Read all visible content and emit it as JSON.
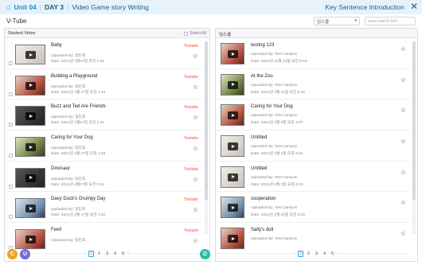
{
  "header": {
    "unit": "Unit 04",
    "day": "DAY 3",
    "lesson": "Video Game story Writing",
    "link": "Key Sentence Introduction"
  },
  "toolbar": {
    "section_title": "V-Tube",
    "sort_value": "임스쿨",
    "search_placeholder": "input search text"
  },
  "left_panel": {
    "title": "Student Video",
    "select_all": "Select All",
    "items": [
      {
        "title": "Baby",
        "uploaded": "Uploaded By: 정민호",
        "date": "Date: 2021년 4월27일 오전 1:25",
        "source": "Youtube",
        "thumb": "light"
      },
      {
        "title": "Building a Playground",
        "uploaded": "Uploaded By: 정민호",
        "date": "Date: 2021년 4월 27일 오전 1:43",
        "source": "Youtube",
        "thumb": "red"
      },
      {
        "title": "Buzz and Ted Are Friends",
        "uploaded": "Uploaded By: 정민호",
        "date": "Date: 2021년 4월27일 오전 1:43",
        "source": "Youtube",
        "thumb": "dark"
      },
      {
        "title": "Caring for Your Dog",
        "uploaded": "Uploaded By: 정민호",
        "date": "Date: 2021년 4월 27일 오전 1:53",
        "source": "Youtube",
        "thumb": "green"
      },
      {
        "title": "Dinosaur",
        "uploaded": "Uploaded By: 정민호",
        "date": "Date: 2021년 4월27일 오전 0:53",
        "source": "Youtube",
        "thumb": "dark"
      },
      {
        "title": "Davy Duck's Grumpy Day",
        "uploaded": "Uploaded By: 정민호",
        "date": "Date: 2021년 4월 27일 오전 1:40",
        "source": "Youtube",
        "thumb": "blue"
      },
      {
        "title": "Feet!",
        "uploaded": "Uploaded By: 정민호",
        "date": "",
        "source": "Youtube",
        "thumb": "red"
      }
    ],
    "pages": [
      "1",
      "2",
      "3",
      "4",
      "5"
    ]
  },
  "right_panel": {
    "title": "임스쿨",
    "items": [
      {
        "title": "testing 123",
        "uploaded": "Uploaded By: Test Campus",
        "date": "Date: 2021년 11월 24일 오전 6:18",
        "thumb": "red"
      },
      {
        "title": "At the Zoo",
        "uploaded": "Uploaded By: Test Campus",
        "date": "Date: 2021년 3월 11일 오전 6:48",
        "thumb": "green"
      },
      {
        "title": "Caring for Your Dog",
        "uploaded": "Uploaded By: Test Campus",
        "date": "Date: 2021년 3월 8일 오후 2:07",
        "thumb": "red"
      },
      {
        "title": "Untitled",
        "uploaded": "Uploaded By: Test Campus",
        "date": "Date: 2021년 2월 2일 오후 6:02",
        "thumb": "light"
      },
      {
        "title": "Untitled",
        "uploaded": "Uploaded By: Test Campus",
        "date": "Date: 2021년 2월 2일 오후 6:03",
        "thumb": "light"
      },
      {
        "title": "cooperation",
        "uploaded": "Uploaded By: Test Campus",
        "date": "Date: 2021년 1월 26일 오전 8:22",
        "thumb": "blue"
      },
      {
        "title": "Sally's doll",
        "uploaded": "Uploaded By: Test Campus",
        "date": "",
        "thumb": "red"
      }
    ],
    "pages": [
      "1",
      "2",
      "3",
      "4",
      "5"
    ]
  },
  "fabs": {
    "orange_label": "C",
    "purple_label": "U",
    "teal_label": "D"
  },
  "colors": {
    "accent": "#1a8fd1",
    "youtube": "#e8572e",
    "orange": "#f2a225",
    "purple": "#6c6fd8",
    "teal": "#2dbca3"
  },
  "icons": [
    "home-icon",
    "close-icon",
    "play-icon",
    "star-icon",
    "chevron-left-icon",
    "chevron-right-icon"
  ]
}
